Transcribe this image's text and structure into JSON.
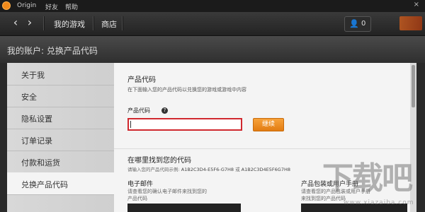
{
  "menubar": {
    "items": [
      "Origin",
      "好友",
      "帮助"
    ],
    "close": "×"
  },
  "toolbar": {
    "back": "‹",
    "forward": "›",
    "my_games": "我的游戏",
    "store": "商店",
    "friends_count": "0"
  },
  "header": {
    "title": "我的账户: 兑换产品代码"
  },
  "sidebar": {
    "items": [
      {
        "label": "关于我"
      },
      {
        "label": "安全"
      },
      {
        "label": "隐私设置"
      },
      {
        "label": "订单记录"
      },
      {
        "label": "付款和运货"
      },
      {
        "label": "兑换产品代码"
      }
    ],
    "active_index": 5
  },
  "main": {
    "section_title": "产品代码",
    "section_desc": "在下面输入您的产品代码以兑换您的游戏或游戏中内容",
    "field_label": "产品代码",
    "help": "?",
    "input_value": "",
    "continue_label": "继续",
    "find_title": "在哪里找到您的代码",
    "find_example_label": "请输入您的产品代码示例:",
    "example_code_1": "A1B2C3D4-E5F6-G7H8",
    "example_or": "或",
    "example_code_2": "A1B2C3D4E5F6G7H8",
    "email_title": "电子邮件",
    "email_desc_1": "请查看您的确认电子邮件来找到您的",
    "email_desc_2": "产品代码",
    "pkg_title": "产品包装或用户手册",
    "pkg_desc_1": "请查看您的产品包装或用户手册",
    "pkg_desc_2": "来找到您的产品代码"
  },
  "watermark": {
    "big": "下载吧",
    "small": "www.xiazaiba.com"
  },
  "colors": {
    "accent": "#f08a1c",
    "input_error_border": "#d0282e"
  }
}
